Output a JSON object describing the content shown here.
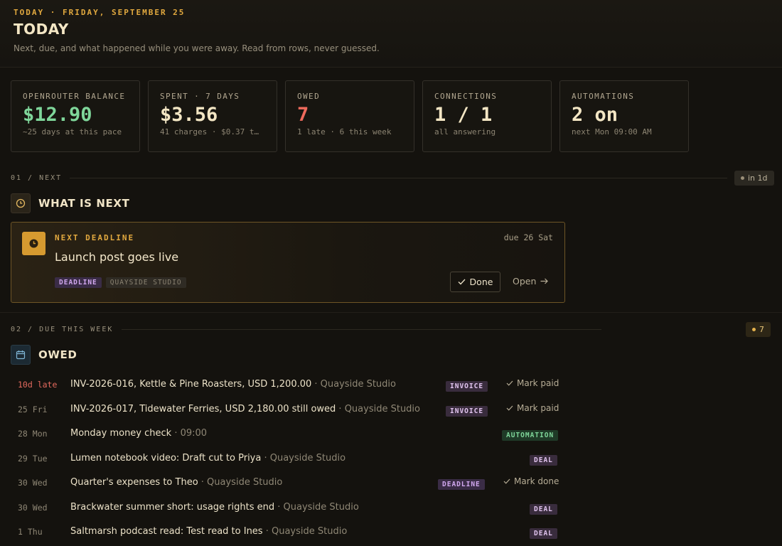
{
  "header": {
    "eyebrow": "TODAY · FRIDAY, SEPTEMBER 25",
    "title": "TODAY",
    "subtitle": "Next, due, and what happened while you were away. Read from rows, never guessed."
  },
  "stats": [
    {
      "label": "OPENROUTER BALANCE",
      "value": "$12.90",
      "sub": "~25 days at this pace",
      "color": "#7fd69a"
    },
    {
      "label": "SPENT · 7 DAYS",
      "value": "$3.56",
      "sub": "41 charges · $0.37 t…",
      "color": "#f3e6c4"
    },
    {
      "label": "OWED",
      "value": "7",
      "sub": "1 late · 6 this week",
      "color": "#ef6a5c"
    },
    {
      "label": "CONNECTIONS",
      "value": "1 / 1",
      "sub": "all answering",
      "color": "#f3e6c4"
    },
    {
      "label": "AUTOMATIONS",
      "value": "2 on",
      "sub": "next Mon 09:00 AM",
      "color": "#f3e6c4"
    }
  ],
  "next_section": {
    "label": "01 / NEXT",
    "pill": "in 1d",
    "title": "WHAT IS NEXT",
    "icon": "clock-icon",
    "card": {
      "eyebrow": "NEXT DEADLINE",
      "due": "due 26 Sat",
      "title": "Launch post goes live",
      "tags": [
        "DEADLINE",
        "QUAYSIDE STUDIO"
      ],
      "done_label": "Done",
      "open_label": "Open"
    }
  },
  "owed_section": {
    "label": "02 / DUE THIS WEEK",
    "pill": "7",
    "title": "OWED",
    "icon": "calendar-icon",
    "rows": [
      {
        "date": "10d late",
        "title": "INV-2026-016, Kettle & Pine Roasters, USD 1,200.00",
        "meta": " · Quayside Studio",
        "tag": "INVOICE",
        "action": "Mark paid"
      },
      {
        "date": "25 Fri",
        "title": "INV-2026-017, Tidewater Ferries, USD 2,180.00 still owed",
        "meta": " · Quayside Studio",
        "tag": "INVOICE",
        "action": "Mark paid"
      },
      {
        "date": "28 Mon",
        "title": "Monday money check",
        "meta": " · 09:00",
        "tag": "AUTOMATION",
        "action": ""
      },
      {
        "date": "29 Tue",
        "title": "Lumen notebook video: Draft cut to Priya",
        "meta": " · Quayside Studio",
        "tag": "DEAL",
        "action": ""
      },
      {
        "date": "30 Wed",
        "title": "Quarter's expenses to Theo",
        "meta": " · Quayside Studio",
        "tag": "DEADLINE",
        "action": "Mark done"
      },
      {
        "date": "30 Wed",
        "title": "Brackwater summer short: usage rights end",
        "meta": " · Quayside Studio",
        "tag": "DEAL",
        "action": ""
      },
      {
        "date": "1 Thu",
        "title": "Saltmarsh podcast read: Test read to Ines",
        "meta": " · Quayside Studio",
        "tag": "DEAL",
        "action": ""
      }
    ]
  }
}
